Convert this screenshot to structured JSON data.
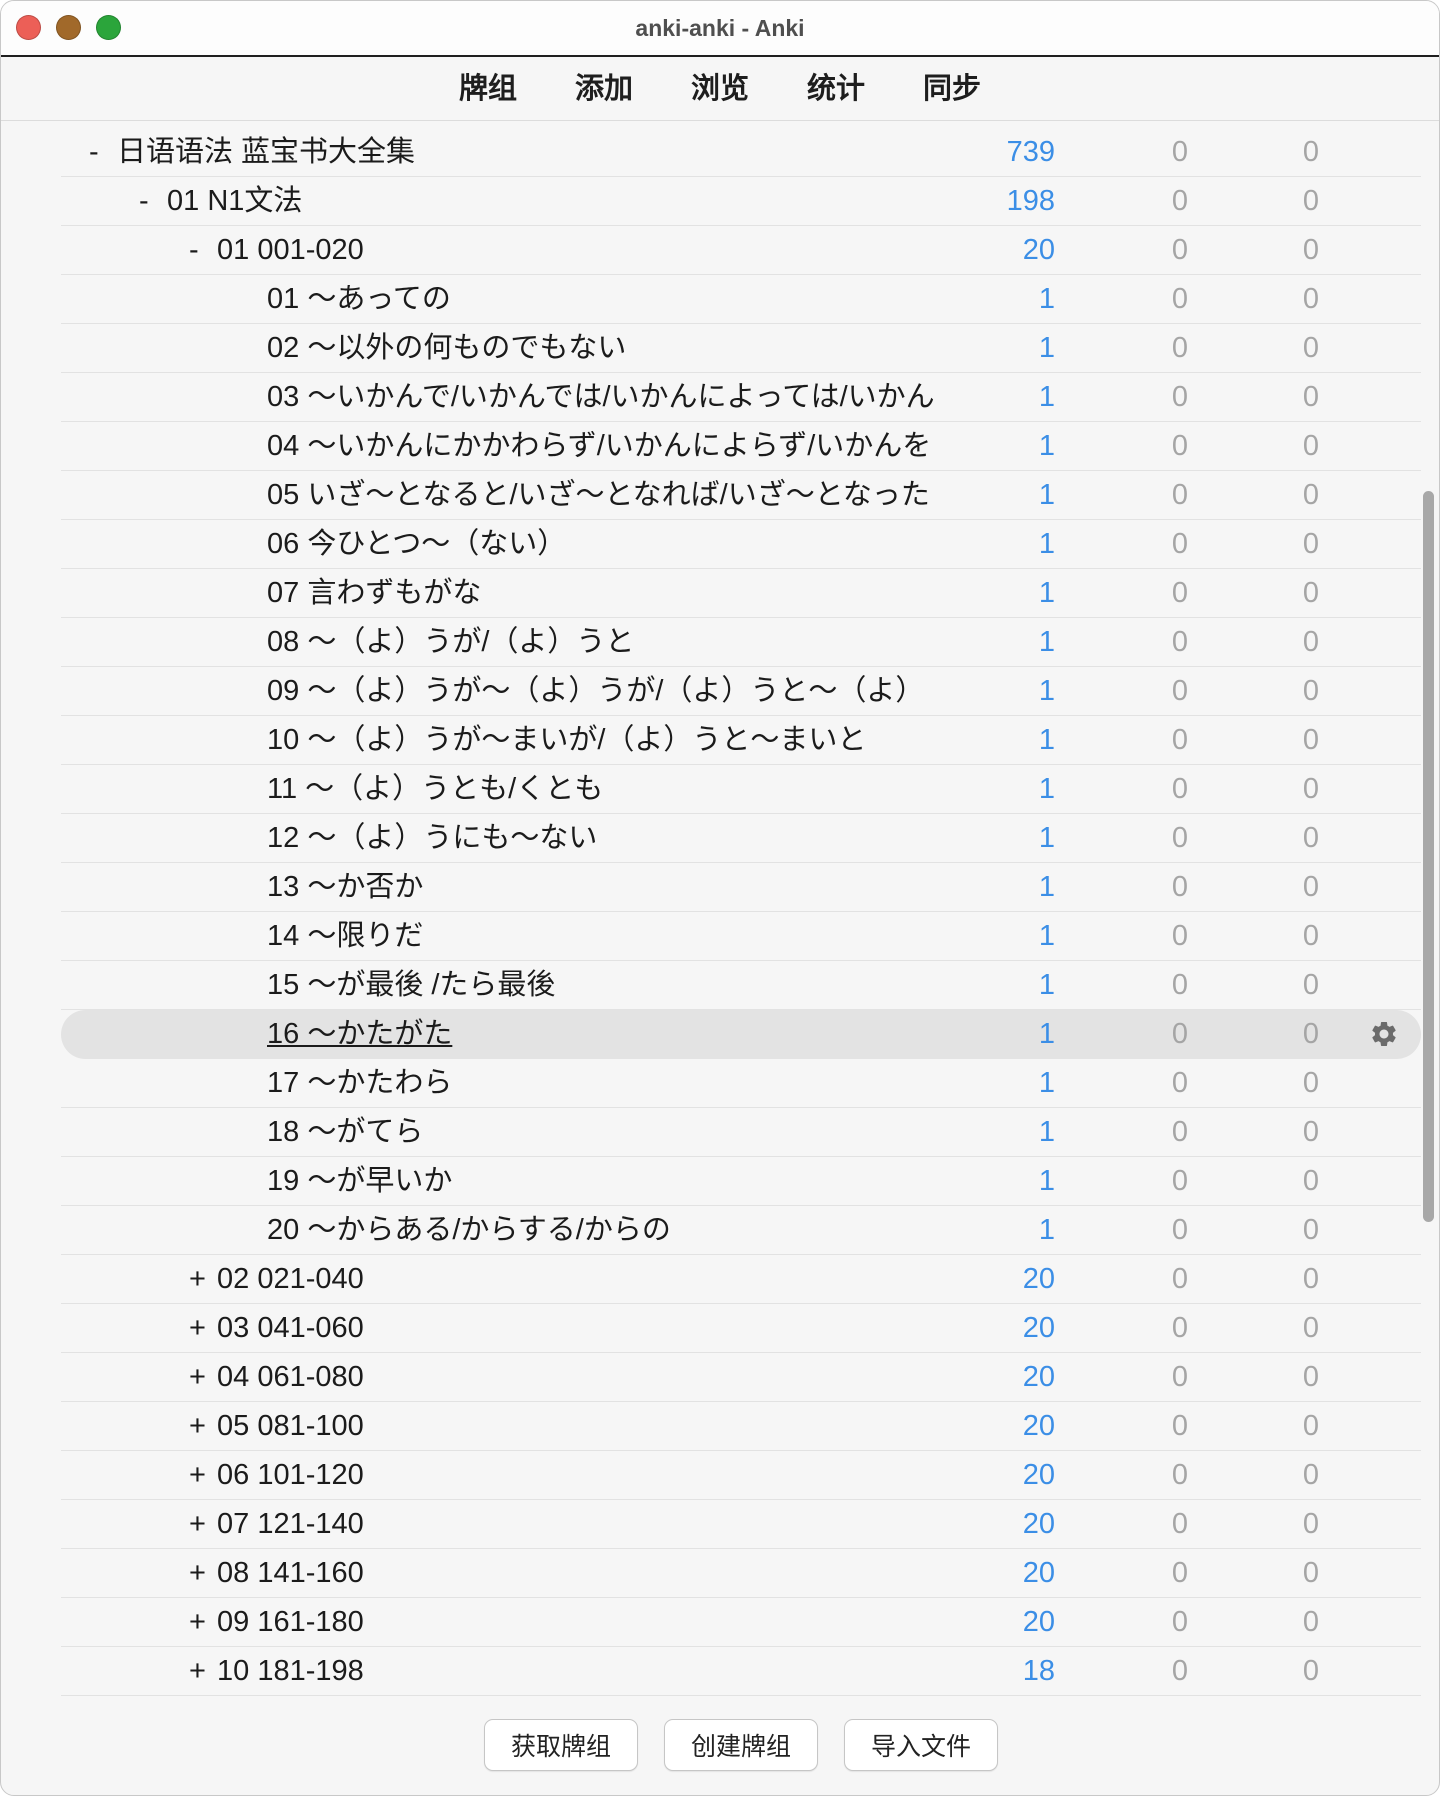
{
  "window": {
    "title": "anki-anki - Anki",
    "traffic_lights": {
      "close": "#ec5f57",
      "minimize": "#a1692a",
      "zoom": "#2ba53b"
    }
  },
  "toolbar": {
    "items": [
      "牌组",
      "添加",
      "浏览",
      "统计",
      "同步"
    ]
  },
  "colors": {
    "new_count": "#3b8ee6",
    "zero_count": "#a5a5a5",
    "current_row": "#e3e3e3",
    "text": "#1b1b1b"
  },
  "row_options_icon": "gear-icon",
  "decks": [
    {
      "toggle": "-",
      "name": "日语语法 蓝宝书大全集",
      "depth": 0,
      "new": 739,
      "learn": 0,
      "due": 0
    },
    {
      "toggle": "-",
      "name": "01 N1文法",
      "depth": 1,
      "new": 198,
      "learn": 0,
      "due": 0
    },
    {
      "toggle": "-",
      "name": "01 001-020",
      "depth": 2,
      "new": 20,
      "learn": 0,
      "due": 0
    },
    {
      "toggle": "",
      "name": "01 ～あっての",
      "depth": 3,
      "new": 1,
      "learn": 0,
      "due": 0
    },
    {
      "toggle": "",
      "name": "02 ～以外の何ものでもない",
      "depth": 3,
      "new": 1,
      "learn": 0,
      "due": 0
    },
    {
      "toggle": "",
      "name": "03 ～いかんで/いかんでは/いかんによっては/いかん",
      "depth": 3,
      "new": 1,
      "learn": 0,
      "due": 0
    },
    {
      "toggle": "",
      "name": "04 ～いかんにかかわらず/いかんによらず/いかんを",
      "depth": 3,
      "new": 1,
      "learn": 0,
      "due": 0
    },
    {
      "toggle": "",
      "name": "05 いざ～となると/いざ～となれば/いざ～となった",
      "depth": 3,
      "new": 1,
      "learn": 0,
      "due": 0
    },
    {
      "toggle": "",
      "name": "06 今ひとつ～（ない）",
      "depth": 3,
      "new": 1,
      "learn": 0,
      "due": 0
    },
    {
      "toggle": "",
      "name": "07 言わずもがな",
      "depth": 3,
      "new": 1,
      "learn": 0,
      "due": 0
    },
    {
      "toggle": "",
      "name": "08 ～（よ）うが/（よ）うと",
      "depth": 3,
      "new": 1,
      "learn": 0,
      "due": 0
    },
    {
      "toggle": "",
      "name": "09 ～（よ）うが～（よ）うが/（よ）うと～（よ）",
      "depth": 3,
      "new": 1,
      "learn": 0,
      "due": 0
    },
    {
      "toggle": "",
      "name": "10 ～（よ）うが～まいが/（よ）うと～まいと",
      "depth": 3,
      "new": 1,
      "learn": 0,
      "due": 0
    },
    {
      "toggle": "",
      "name": "11 ～（よ）うとも/くとも",
      "depth": 3,
      "new": 1,
      "learn": 0,
      "due": 0
    },
    {
      "toggle": "",
      "name": "12 ～（よ）うにも～ない",
      "depth": 3,
      "new": 1,
      "learn": 0,
      "due": 0
    },
    {
      "toggle": "",
      "name": "13 ～か否か",
      "depth": 3,
      "new": 1,
      "learn": 0,
      "due": 0
    },
    {
      "toggle": "",
      "name": "14 ～限りだ",
      "depth": 3,
      "new": 1,
      "learn": 0,
      "due": 0
    },
    {
      "toggle": "",
      "name": "15 ～が最後 /たら最後",
      "depth": 3,
      "new": 1,
      "learn": 0,
      "due": 0
    },
    {
      "toggle": "",
      "name": "16 ～かたがた",
      "depth": 3,
      "new": 1,
      "learn": 0,
      "due": 0,
      "current": true
    },
    {
      "toggle": "",
      "name": "17 ～かたわら",
      "depth": 3,
      "new": 1,
      "learn": 0,
      "due": 0
    },
    {
      "toggle": "",
      "name": "18 ～がてら",
      "depth": 3,
      "new": 1,
      "learn": 0,
      "due": 0
    },
    {
      "toggle": "",
      "name": "19 ～が早いか",
      "depth": 3,
      "new": 1,
      "learn": 0,
      "due": 0
    },
    {
      "toggle": "",
      "name": "20 ～からある/からする/からの",
      "depth": 3,
      "new": 1,
      "learn": 0,
      "due": 0
    },
    {
      "toggle": "+",
      "name": "02 021-040",
      "depth": 2,
      "new": 20,
      "learn": 0,
      "due": 0
    },
    {
      "toggle": "+",
      "name": "03 041-060",
      "depth": 2,
      "new": 20,
      "learn": 0,
      "due": 0
    },
    {
      "toggle": "+",
      "name": "04 061-080",
      "depth": 2,
      "new": 20,
      "learn": 0,
      "due": 0
    },
    {
      "toggle": "+",
      "name": "05 081-100",
      "depth": 2,
      "new": 20,
      "learn": 0,
      "due": 0
    },
    {
      "toggle": "+",
      "name": "06 101-120",
      "depth": 2,
      "new": 20,
      "learn": 0,
      "due": 0
    },
    {
      "toggle": "+",
      "name": "07 121-140",
      "depth": 2,
      "new": 20,
      "learn": 0,
      "due": 0
    },
    {
      "toggle": "+",
      "name": "08 141-160",
      "depth": 2,
      "new": 20,
      "learn": 0,
      "due": 0
    },
    {
      "toggle": "+",
      "name": "09 161-180",
      "depth": 2,
      "new": 20,
      "learn": 0,
      "due": 0
    },
    {
      "toggle": "+",
      "name": "10 181-198",
      "depth": 2,
      "new": 18,
      "learn": 0,
      "due": 0
    }
  ],
  "footer": {
    "get_shared": "获取牌组",
    "create_deck": "创建牌组",
    "import_file": "导入文件"
  }
}
